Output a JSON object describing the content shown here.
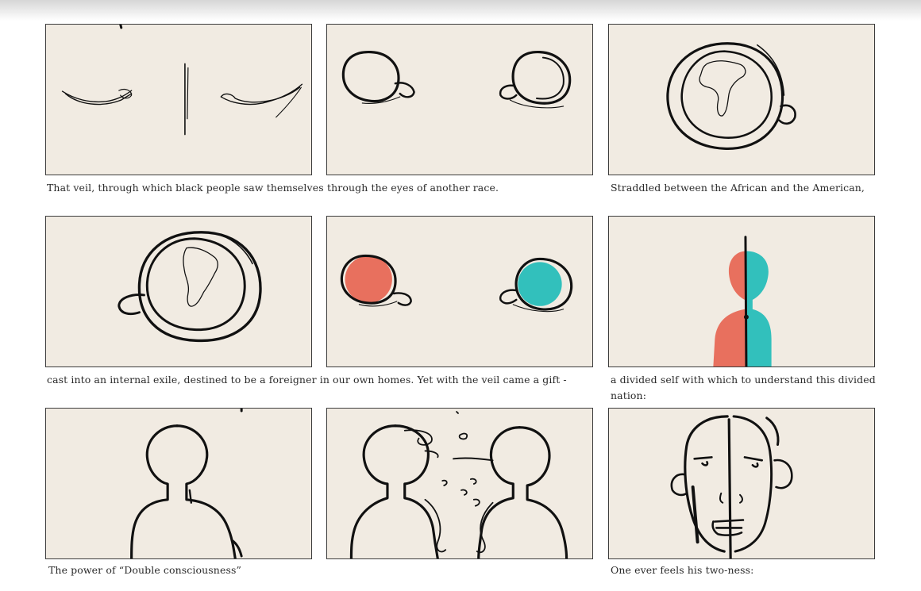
{
  "captions": {
    "c1": "That veil, through which black people saw themselves",
    "c2": "through the eyes of another race.",
    "c3": "Straddled between the African and the American,",
    "c4": "cast into an internal exile, destined to be a foreigner in our own homes. Yet with the veil came a gift -",
    "c6": "a divided self with which to understand this divided nation:",
    "c7": "The power of “Double consciousness”",
    "c9": "One ever feels his two-ness:"
  },
  "colors": {
    "paper": "#f1ebe2",
    "ink": "#111111",
    "coral": "#e8705e",
    "teal": "#32c0bc"
  },
  "panels": [
    {
      "name": "closed-eyes-sketch"
    },
    {
      "name": "two-eyes-sketch"
    },
    {
      "name": "eye-with-africa-sketch"
    },
    {
      "name": "eye-with-south-america-sketch"
    },
    {
      "name": "colored-eyes-sketch"
    },
    {
      "name": "divided-figure-sketch"
    },
    {
      "name": "head-silhouette-sketch"
    },
    {
      "name": "facing-heads-sketch"
    },
    {
      "name": "split-face-sketch"
    }
  ]
}
